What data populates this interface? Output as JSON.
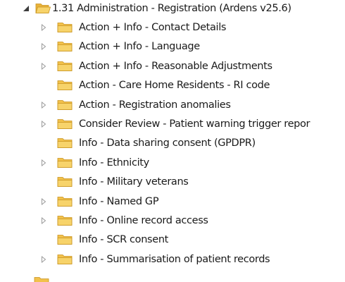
{
  "tree": {
    "root": {
      "label": "1.31 Administration - Registration (Ardens v25.6)",
      "expanded": true,
      "icon": "folder-open-icon"
    },
    "children": [
      {
        "label": "Action + Info - Contact Details",
        "expandable": true
      },
      {
        "label": "Action + Info - Language",
        "expandable": true
      },
      {
        "label": "Action + Info - Reasonable Adjustments",
        "expandable": true
      },
      {
        "label": "Action - Care Home Residents - RI code",
        "expandable": false
      },
      {
        "label": "Action - Registration anomalies",
        "expandable": true
      },
      {
        "label": "Consider Review - Patient warning trigger repor",
        "expandable": true
      },
      {
        "label": "Info - Data sharing consent (GPDPR)",
        "expandable": false
      },
      {
        "label": "Info - Ethnicity",
        "expandable": true
      },
      {
        "label": "Info - Military veterans",
        "expandable": false
      },
      {
        "label": "Info - Named GP",
        "expandable": true
      },
      {
        "label": "Info - Online record access",
        "expandable": true
      },
      {
        "label": "Info - SCR consent",
        "expandable": false
      },
      {
        "label": "Info - Summarisation of patient records",
        "expandable": true
      }
    ]
  },
  "colors": {
    "folder_body": "#f2c14b",
    "folder_front": "#f7d36a",
    "folder_edge": "#c8931f",
    "toggle_collapsed": "#9a9a9a",
    "toggle_expanded": "#3c3c3c",
    "text": "#1a1a1a"
  }
}
